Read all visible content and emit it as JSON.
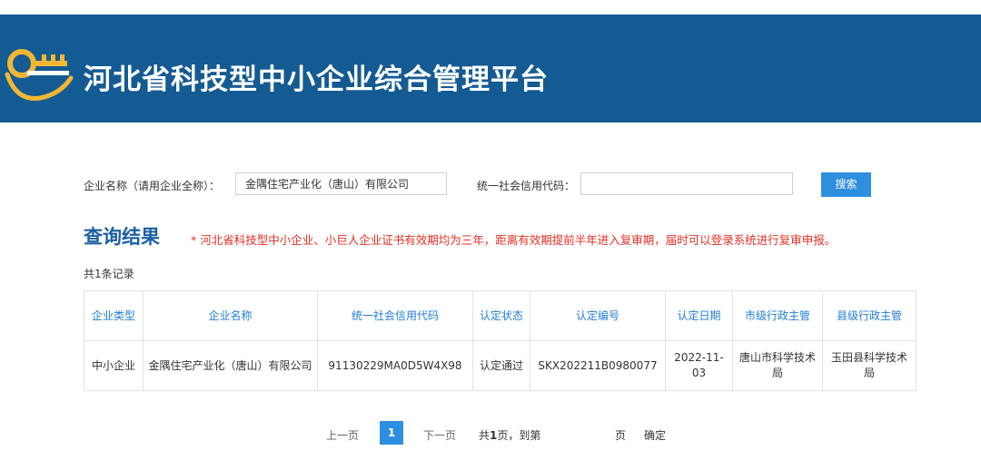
{
  "header": {
    "title": "河北省科技型中小企业综合管理平台",
    "logo_icon": "key-logo-icon",
    "logo_colors": [
      "#f3b733",
      "#ffffff"
    ],
    "background": "#155b93"
  },
  "search": {
    "company_label": "企业名称（请用企业全称）：",
    "company_value": "金隅住宅产业化（唐山）有限公司",
    "credit_label": "统一社会信用代码：",
    "credit_value": "",
    "button": "搜索"
  },
  "results": {
    "title": "查询结果",
    "notice": "* 河北省科技型中小企业、小巨人企业证书有效期均为三年，距离有效期提前半年进入复审期，届时可以登录系统进行复审申报。",
    "count": "共1条记录",
    "columns": [
      "企业类型",
      "企业名称",
      "统一社会信用代码",
      "认定状态",
      "认定编号",
      "认定日期",
      "市级行政主管",
      "县级行政主管"
    ],
    "rows": [
      {
        "type": "中小企业",
        "name": "金隅住宅产业化（唐山）有限公司",
        "credit_code": "91130229MA0D5W4X98",
        "status": "认定通过",
        "cert_no": "SKX202211B0980077",
        "date": "2022-11-03",
        "city_admin": "唐山市科学技术局",
        "county_admin": "玉田县科学技术局"
      }
    ]
  },
  "pagination": {
    "prev": "上一页",
    "current": "1",
    "next": "下一页",
    "total_prefix": "共",
    "total_pages": "1",
    "total_suffix": "页，到第",
    "page_suffix": "页",
    "confirm": "确定"
  },
  "colors": {
    "accent": "#2e8ee0",
    "title_blue": "#1b5fa3",
    "header_text": "#1f7ed6",
    "notice_red": "#e53022"
  }
}
